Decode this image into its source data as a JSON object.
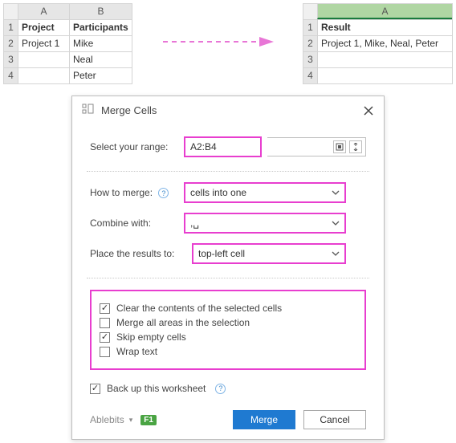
{
  "left_table": {
    "columns": [
      "A",
      "B"
    ],
    "headers": [
      "Project",
      "Participants"
    ],
    "rows": [
      [
        "Project 1",
        "Mike"
      ],
      [
        "",
        "Neal"
      ],
      [
        "",
        "Peter"
      ]
    ],
    "row_numbers": [
      "1",
      "2",
      "3",
      "4"
    ]
  },
  "right_table": {
    "columns": [
      "A"
    ],
    "headers": [
      "Result"
    ],
    "rows": [
      [
        "Project 1, Mike, Neal, Peter"
      ],
      [
        ""
      ],
      [
        ""
      ]
    ],
    "row_numbers": [
      "1",
      "2",
      "3",
      "4"
    ]
  },
  "dialog": {
    "title": "Merge Cells",
    "range_label": "Select your range:",
    "range_value": "A2:B4",
    "how_label": "How to merge:",
    "how_value": "cells into one",
    "combine_label": "Combine with:",
    "combine_value": ",␣",
    "place_label": "Place the results to:",
    "place_value": "top-left cell",
    "check1": "Clear the contents of the selected cells",
    "check1_state": "✓",
    "check2": "Merge all areas in the selection",
    "check2_state": "",
    "check3": "Skip empty cells",
    "check3_state": "✓",
    "check4": "Wrap text",
    "check4_state": "",
    "backup_label": "Back up this worksheet",
    "backup_state": "✓",
    "brand": "Ablebits",
    "fn_badge": "F1",
    "merge_btn": "Merge",
    "cancel_btn": "Cancel"
  }
}
